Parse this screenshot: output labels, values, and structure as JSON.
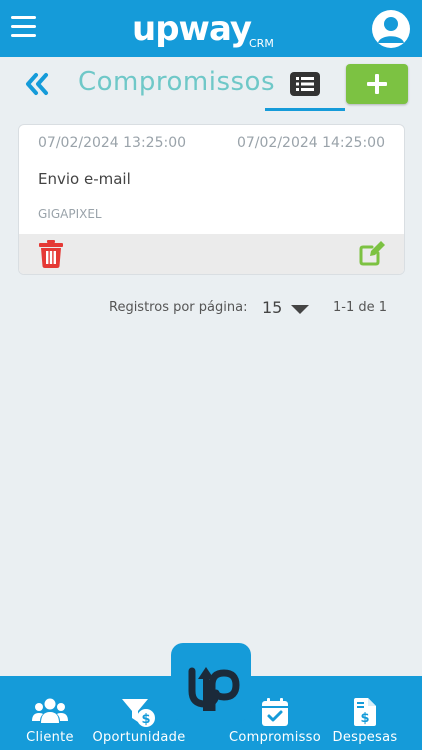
{
  "header": {
    "logo_text": "upway",
    "logo_sub": "CRM"
  },
  "subheader": {
    "title": "Compromissos"
  },
  "appointments": [
    {
      "start": "07/02/2024  13:25:00",
      "end": "07/02/2024  14:25:00",
      "title": "Envio e-mail",
      "client": "GIGAPIXEL"
    }
  ],
  "pagination": {
    "label": "Registros por página:",
    "per_page": "15",
    "range": "1-1 de 1"
  },
  "bottom_nav": {
    "cliente": "Cliente",
    "oportunidade": "Oportunidade",
    "compromisso": "Compromisso",
    "despesas": "Despesas"
  },
  "colors": {
    "primary": "#159bd9",
    "accent_green": "#7cc242",
    "title_teal": "#6fc8c8",
    "delete_red": "#e53935"
  },
  "icons": [
    "menu-icon",
    "user-icon",
    "double-chevron-left-icon",
    "list-icon",
    "plus-icon",
    "trash-icon",
    "edit-icon",
    "caret-down-icon",
    "users-icon",
    "funnel-dollar-icon",
    "calendar-check-icon",
    "invoice-dollar-icon",
    "upway-logo-icon"
  ]
}
